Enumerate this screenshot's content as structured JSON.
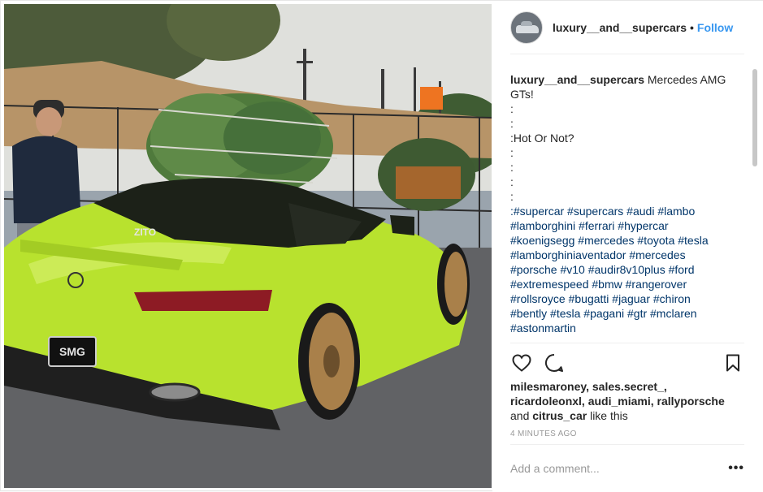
{
  "post": {
    "username": "luxury__and__supercars",
    "separator": "•",
    "follow_label": "Follow"
  },
  "caption": {
    "username": "luxury__and__supercars",
    "lines": [
      " Mercedes AMG GTs!",
      ":",
      ":",
      ":Hot Or Not?",
      ":",
      ":",
      ":",
      ":"
    ],
    "hashtags": [
      ":#supercar #supercars #audi #lambo",
      "#lamborghini #ferrari #hypercar",
      "#koenigsegg #mercedes #toyota #tesla",
      "#lamborghiniaventador #mercedes",
      "#porsche #v10 #audir8v10plus #ford",
      "#extremespeed #bmw #rangerover",
      "#rollsroyce #bugatti #jaguar #chiron",
      "#bently #tesla #pagani #gtr #mclaren",
      "#astonmartin"
    ]
  },
  "actions": {
    "like_icon": "heart-icon",
    "comment_icon": "comment-bubble-icon",
    "save_icon": "bookmark-icon"
  },
  "likes": {
    "line1": "milesmaroney, sales.secret_,",
    "line2": "ricardoleonxl, audi_miami, rallyporsche",
    "and_text": "and ",
    "last_user": "citrus_car",
    "suffix": " like this"
  },
  "timestamp": "4 MINUTES AGO",
  "comment_box": {
    "placeholder": "Add a comment...",
    "more_label": "•••"
  },
  "photo": {
    "plate_text": "SMG",
    "window_decal": "ZITO",
    "colors": {
      "car": "#b8e22e",
      "wheel": "#a9804a",
      "tree": "#4f7a3c",
      "sky": "#dcdcd8",
      "asphalt": "#5a5c5f"
    }
  }
}
